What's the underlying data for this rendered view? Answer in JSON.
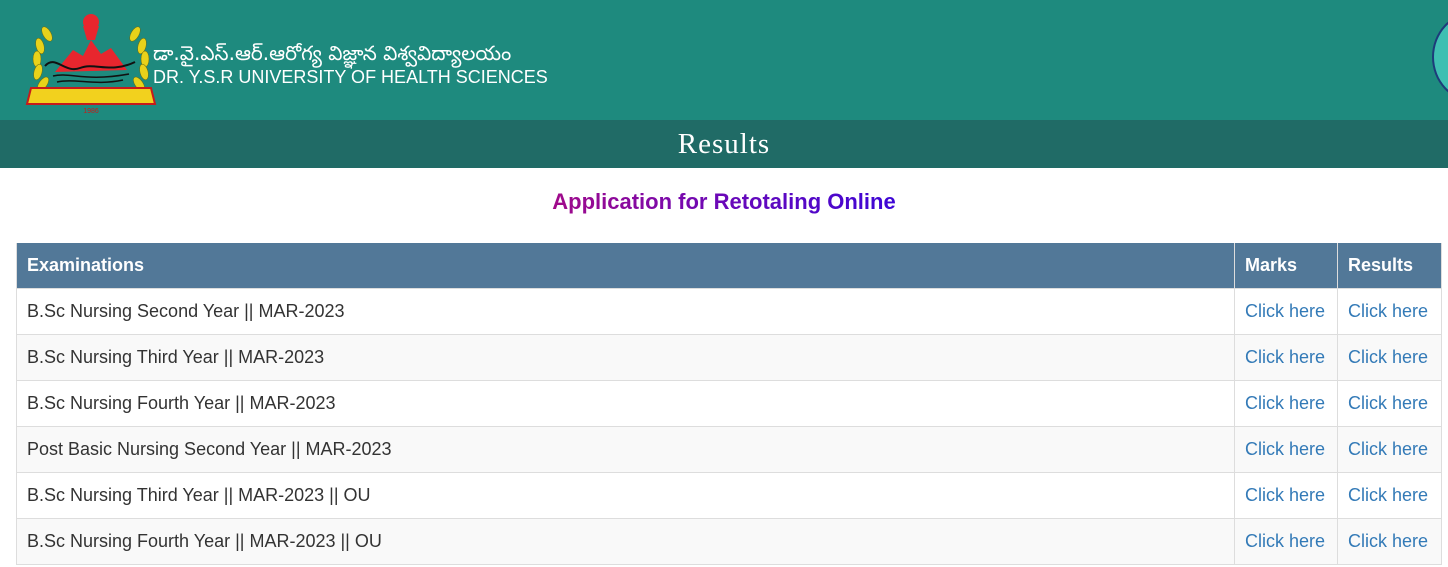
{
  "header": {
    "title_telugu": "డా.వై.ఎస్.ఆర్.ఆరోగ్య విజ్ఞాన విశ్వవిద్యాలయం",
    "title_english": "DR. Y.S.R UNIVERSITY OF HEALTH SCIENCES",
    "logo_icon": "university-emblem-icon",
    "logo_year": "1986",
    "brand_color": "#1e8a7e"
  },
  "banner": {
    "title": "Results",
    "color": "#206b66"
  },
  "subheading": "Application for Retotaling Online",
  "table": {
    "headers": [
      "Examinations",
      "Marks",
      "Results"
    ],
    "header_color": "#527898",
    "link_color": "#337ab7",
    "rows": [
      {
        "exam": "B.Sc Nursing Second Year || MAR-2023",
        "marks": "Click here",
        "results": "Click here"
      },
      {
        "exam": "B.Sc Nursing Third Year || MAR-2023",
        "marks": "Click here",
        "results": "Click here"
      },
      {
        "exam": "B.Sc Nursing Fourth Year || MAR-2023",
        "marks": "Click here",
        "results": "Click here"
      },
      {
        "exam": "Post Basic Nursing Second Year || MAR-2023",
        "marks": "Click here",
        "results": "Click here"
      },
      {
        "exam": "B.Sc Nursing Third Year || MAR-2023 || OU",
        "marks": "Click here",
        "results": "Click here"
      },
      {
        "exam": "B.Sc Nursing Fourth Year || MAR-2023 || OU",
        "marks": "Click here",
        "results": "Click here"
      }
    ]
  }
}
